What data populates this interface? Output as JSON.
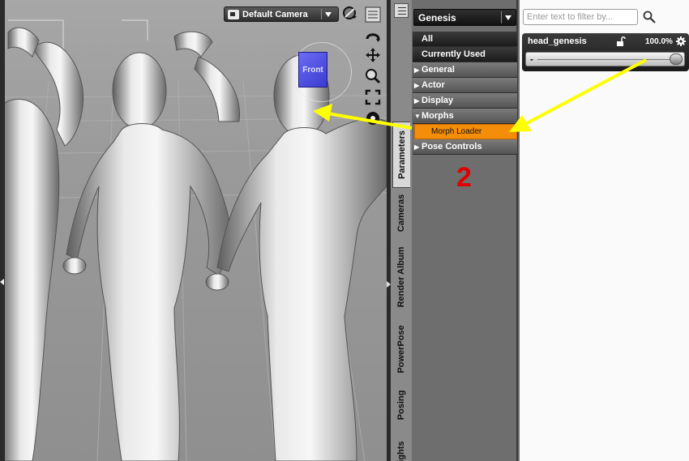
{
  "viewport": {
    "camera_label": "Default Camera",
    "view_cube_label": "Front"
  },
  "tabs": [
    {
      "label": "Parameters",
      "active": true
    },
    {
      "label": "Cameras",
      "active": false
    },
    {
      "label": "Render Album",
      "active": false
    },
    {
      "label": "PowerPose",
      "active": false
    },
    {
      "label": "Posing",
      "active": false
    },
    {
      "label": "Lights",
      "active": false
    }
  ],
  "tree": {
    "scope_label": "Genesis",
    "all_label": "All",
    "currently_used_label": "Currently Used",
    "groups": {
      "general": "General",
      "actor": "Actor",
      "display": "Display",
      "morphs": "Morphs",
      "morph_loader": "Morph Loader",
      "pose_controls": "Pose Controls"
    }
  },
  "annotation": {
    "step_number": "2",
    "color": "#ffff00",
    "number_color": "#e00000"
  },
  "properties": {
    "filter_placeholder": "Enter text to filter by...",
    "name": "head_genesis",
    "value_text": "100.0%",
    "slider_fraction": 1.0,
    "minus_label": "-"
  },
  "colors": {
    "selected_item": "#f48d0a",
    "view_cube": "#5050e0"
  }
}
